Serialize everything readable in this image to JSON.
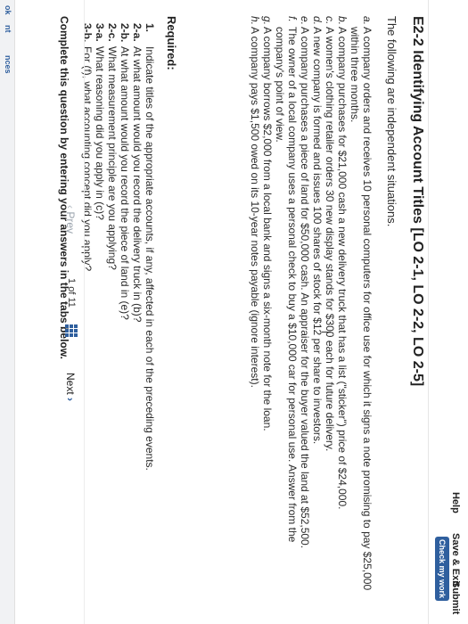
{
  "header": {
    "help_label": "Help",
    "save_exit_label": "Save & Exit",
    "submit_label": "Submit",
    "check_work_label": "Check my work"
  },
  "gutter": {
    "tab_ok": "ok",
    "tab_nces": "nces",
    "tab_nt": "nt"
  },
  "question": {
    "title": "E2-2 Identifying Account Titles [LO 2-1, LO 2-2, LO 2-5]",
    "intro": "The following are independent situations.",
    "situations": [
      {
        "letter": "a.",
        "text": "A company orders and receives 10 personal computers for office use for which it signs a note promising to pay $25,000 within three months."
      },
      {
        "letter": "b.",
        "text": "A company purchases for $21,000 cash a new delivery truck that has a list (\"sticker\") price of $24,000."
      },
      {
        "letter": "c.",
        "text": "A women's clothing retailer orders 30 new display stands for $300 each for future delivery."
      },
      {
        "letter": "d.",
        "text": "A new company is formed and issues 100 shares of stock for $12 per share to investors."
      },
      {
        "letter": "e.",
        "text": "A company purchases a piece of land for $50,000 cash. An appraiser for the buyer valued the land at $52,500."
      },
      {
        "letter": "f.",
        "text": "The owner of a local company uses a personal check to buy a $10,000 car for personal use. Answer from the company's point of view."
      },
      {
        "letter": "g.",
        "text": "A company borrows $2,000 from a local bank and signs a six-month note for the loan."
      },
      {
        "letter": "h.",
        "text": "A company pays $1,500 owed on its 10-year notes payable (ignore interest)."
      }
    ],
    "required_heading": "Required:",
    "requirements": [
      {
        "label": "1.",
        "text": "Indicate titles of the appropriate accounts, if any, affected in each of the preceding events."
      },
      {
        "label": "2-a.",
        "text": "At what amount would you record the delivery truck in (b)?"
      },
      {
        "label": "2-b.",
        "text": "At what amount would you record the piece of land in (e)?"
      },
      {
        "label": "2-c.",
        "text": "What measurement principle are you applying?"
      },
      {
        "label": "3-a.",
        "text": "What reasoning did you apply in (c)?"
      },
      {
        "label": "3-b.",
        "text": "For (f), what accounting concept did you apply?"
      }
    ],
    "complete_note": "Complete this question by entering your answers in the tabs below."
  },
  "pager": {
    "prev_label": "Prev",
    "page_current": "1",
    "page_of": "of",
    "page_total": "11",
    "next_label": "Next",
    "accent": "#2f5f9e"
  }
}
